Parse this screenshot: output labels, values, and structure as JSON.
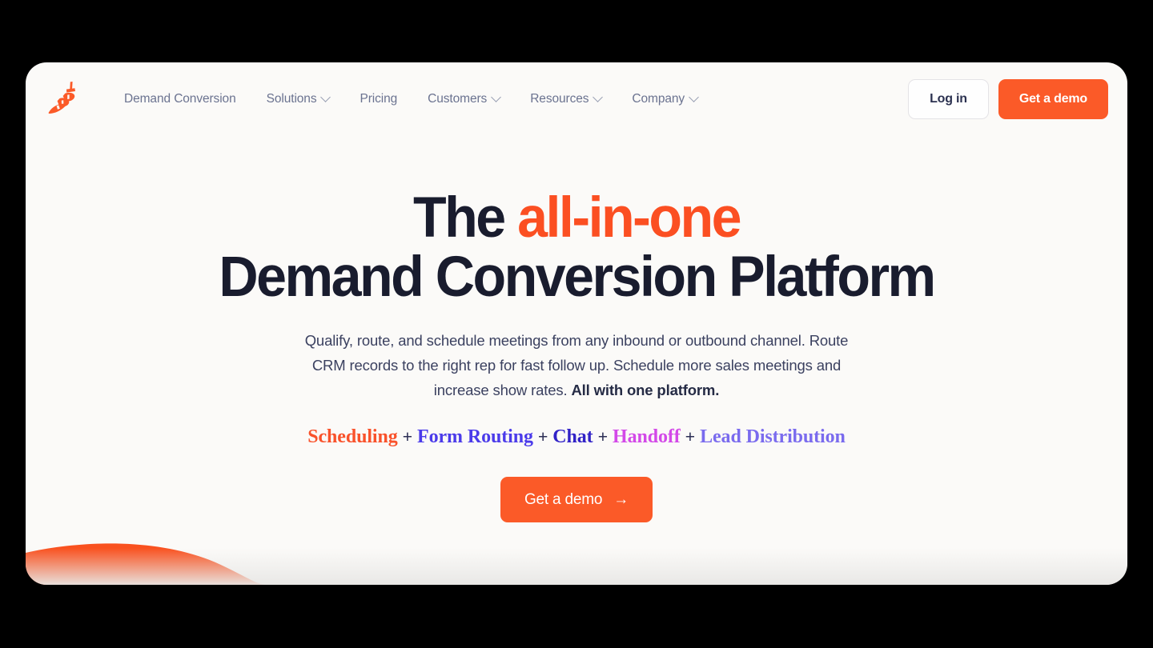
{
  "brand": {
    "logo_icon": "chili-pepper-logo",
    "accent_color": "#FB5A28",
    "headline_dark_color": "#191C2E",
    "card_background": "#FBFAF8",
    "page_background": "#000000"
  },
  "header": {
    "nav": [
      {
        "label": "Demand Conversion",
        "has_dropdown": false
      },
      {
        "label": "Solutions",
        "has_dropdown": true
      },
      {
        "label": "Pricing",
        "has_dropdown": false
      },
      {
        "label": "Customers",
        "has_dropdown": true
      },
      {
        "label": "Resources",
        "has_dropdown": true
      },
      {
        "label": "Company",
        "has_dropdown": true
      }
    ],
    "login_label": "Log in",
    "demo_label": "Get a demo"
  },
  "hero": {
    "headline_line1_prefix": "The ",
    "headline_line1_accent": "all-in-one",
    "headline_line2": "Demand Conversion Platform",
    "subhead_part1": "Qualify, route, and schedule meetings from any inbound or outbound channel. Route CRM records to the right rep for fast follow up. Schedule more sales meetings and increase show rates. ",
    "subhead_bold": "All with one platform.",
    "features": [
      {
        "label": "Scheduling",
        "color": "#F9522B"
      },
      {
        "label": "Form Routing",
        "color": "#4B3BEA"
      },
      {
        "label": "Chat",
        "color": "#3122C7"
      },
      {
        "label": "Handoff",
        "color": "#D349E8"
      },
      {
        "label": "Lead Distribution",
        "color": "#7A6BEE"
      }
    ],
    "feature_separator": "+",
    "cta_label": "Get a demo",
    "cta_arrow": "→"
  },
  "decoration": {
    "wave_color": "#F9511F",
    "wave_name": "orange-wave-shape"
  }
}
